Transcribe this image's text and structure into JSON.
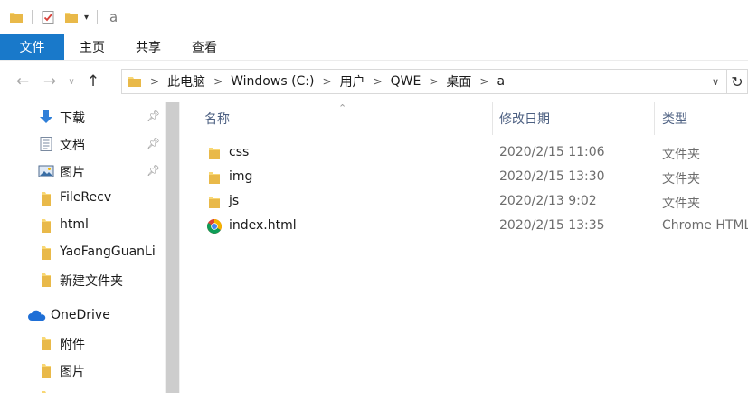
{
  "window": {
    "title": "a"
  },
  "ribbon": {
    "tabs": [
      {
        "label": "文件"
      },
      {
        "label": "主页"
      },
      {
        "label": "共享"
      },
      {
        "label": "查看"
      }
    ]
  },
  "address": {
    "crumbs": [
      "此电脑",
      "Windows (C:)",
      "用户",
      "QWE",
      "桌面",
      "a"
    ]
  },
  "nav": {
    "quick_access": [
      {
        "label": "下载",
        "icon": "download-arrow-icon",
        "pinned": true
      },
      {
        "label": "文档",
        "icon": "document-icon",
        "pinned": true
      },
      {
        "label": "图片",
        "icon": "pictures-icon",
        "pinned": true
      },
      {
        "label": "FileRecv",
        "icon": "folder-icon",
        "pinned": false
      },
      {
        "label": "html",
        "icon": "folder-icon",
        "pinned": false
      },
      {
        "label": "YaoFangGuanLi",
        "icon": "folder-icon",
        "pinned": false
      },
      {
        "label": "新建文件夹",
        "icon": "folder-icon",
        "pinned": false
      }
    ],
    "onedrive": {
      "label": "OneDrive",
      "icon": "cloud-icon",
      "children": [
        {
          "label": "附件",
          "icon": "folder-icon"
        },
        {
          "label": "图片",
          "icon": "folder-icon"
        }
      ]
    }
  },
  "list": {
    "columns": {
      "name": "名称",
      "date": "修改日期",
      "type": "类型"
    },
    "files": [
      {
        "name": "css",
        "date": "2020/2/15 11:06",
        "type": "文件夹",
        "icon": "folder-icon"
      },
      {
        "name": "img",
        "date": "2020/2/15 13:30",
        "type": "文件夹",
        "icon": "folder-icon"
      },
      {
        "name": "js",
        "date": "2020/2/13 9:02",
        "type": "文件夹",
        "icon": "folder-icon"
      },
      {
        "name": "index.html",
        "date": "2020/2/15 13:35",
        "type": "Chrome HTML Document",
        "icon": "chrome-icon"
      }
    ]
  },
  "colors": {
    "file_tab": "#1979ca",
    "folder": "#f8d775",
    "column_header": "#4d6082"
  }
}
